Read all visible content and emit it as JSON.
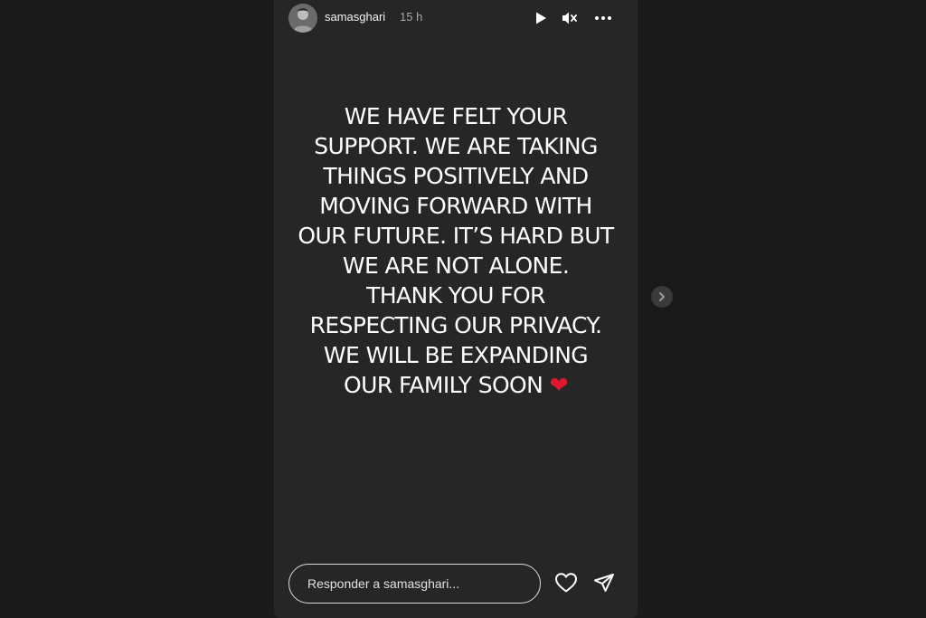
{
  "header": {
    "username": "samasghari",
    "time": "15 h"
  },
  "story": {
    "lines": [
      "WE HAVE FELT YOUR",
      "SUPPORT. WE ARE TAKING",
      "THINGS POSITIVELY AND",
      "MOVING FORWARD WITH",
      "OUR FUTURE. IT’S HARD BUT",
      "WE ARE NOT ALONE.",
      "THANK YOU FOR",
      "RESPECTING OUR PRIVACY.",
      "WE WILL BE EXPANDING",
      "OUR FAMILY SOON"
    ],
    "emoji": "❤"
  },
  "reply": {
    "placeholder": "Responder a samasghari..."
  },
  "icons": {
    "play": "play-icon",
    "mute": "speaker-muted-icon",
    "more": "more-options-icon",
    "like": "heart-icon",
    "share": "send-icon",
    "next": "chevron-right-icon"
  },
  "colors": {
    "background": "#1a1a1a",
    "story_background": "#262626",
    "text": "#ffffff",
    "heart": "#e0182d"
  }
}
